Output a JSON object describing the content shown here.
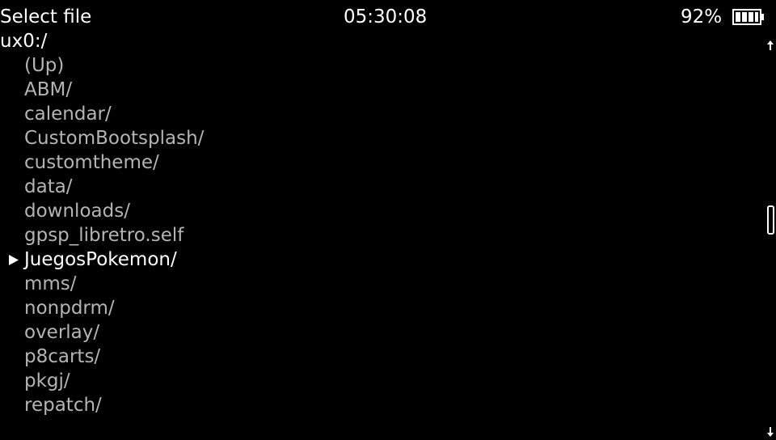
{
  "header": {
    "title": "Select file",
    "clock": "05:30:08",
    "battery_percent": "92%",
    "battery_icon": "battery-icon"
  },
  "location": {
    "path": "ux0:/"
  },
  "file_list": {
    "items": [
      {
        "label": "(Up)",
        "selected": false
      },
      {
        "label": "ABM/",
        "selected": false
      },
      {
        "label": "calendar/",
        "selected": false
      },
      {
        "label": "CustomBootsplash/",
        "selected": false
      },
      {
        "label": "customtheme/",
        "selected": false
      },
      {
        "label": "data/",
        "selected": false
      },
      {
        "label": "downloads/",
        "selected": false
      },
      {
        "label": "gpsp_libretro.self",
        "selected": false
      },
      {
        "label": "JuegosPokemon/",
        "selected": true
      },
      {
        "label": "mms/",
        "selected": false
      },
      {
        "label": "nonpdrm/",
        "selected": false
      },
      {
        "label": "overlay/",
        "selected": false
      },
      {
        "label": "p8carts/",
        "selected": false
      },
      {
        "label": "pkgj/",
        "selected": false
      },
      {
        "label": "repatch/",
        "selected": false
      }
    ],
    "cursor_icon": "triangle-right-icon"
  },
  "scrollbar": {
    "up_icon": "arrow-up-icon",
    "down_icon": "arrow-down-icon"
  },
  "colors": {
    "background": "#000000",
    "text_primary": "#ffffff",
    "text_item": "#b4b4b4"
  }
}
